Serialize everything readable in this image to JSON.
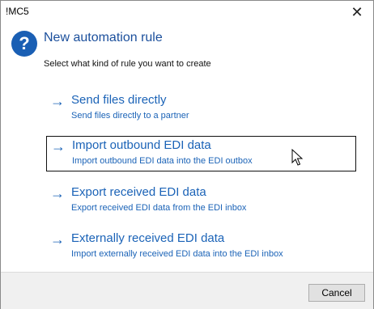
{
  "window": {
    "title": "!MC5",
    "close_glyph": "✕"
  },
  "dialog": {
    "icon": "question-icon",
    "icon_glyph": "?",
    "title": "New automation rule",
    "subtitle": "Select what kind of rule you want to create"
  },
  "options": [
    {
      "title": "Send files directly",
      "description": "Send files directly to a partner"
    },
    {
      "title": "Import outbound EDI data",
      "description": "Import outbound EDI data into the EDI outbox"
    },
    {
      "title": "Export received EDI data",
      "description": "Export received EDI data from the EDI inbox"
    },
    {
      "title": "Externally received EDI data",
      "description": "Import externally received EDI data into the EDI inbox"
    }
  ],
  "option_arrow": "→",
  "footer": {
    "cancel_label": "Cancel"
  },
  "colors": {
    "accent": "#1b63b7",
    "title": "#1b4f9c",
    "footer_bg": "#f0f0f0"
  }
}
